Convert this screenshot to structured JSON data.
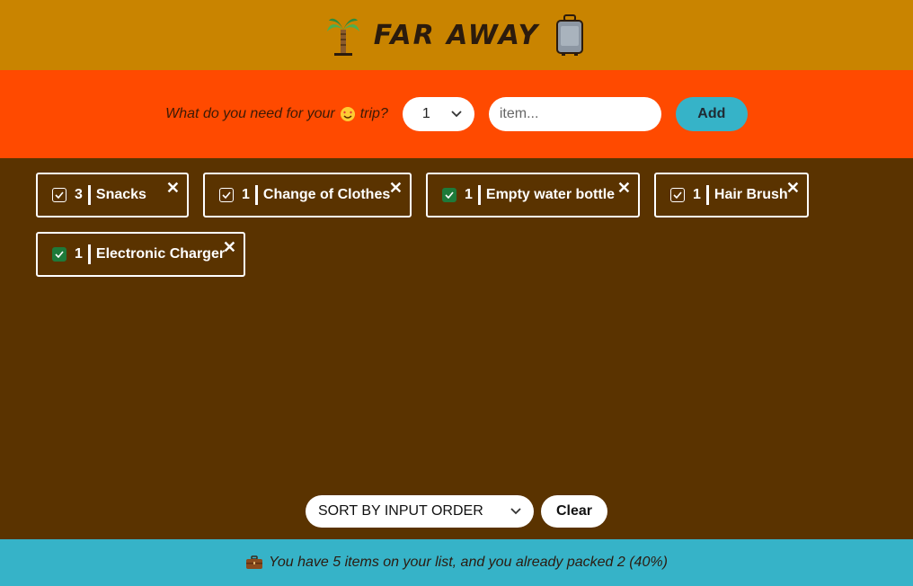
{
  "header": {
    "title": "FAR AWAY",
    "left_icon": "palm-tree-icon",
    "right_icon": "luggage-icon"
  },
  "form": {
    "question": "What do you need for your",
    "question_suffix": "trip?",
    "question_emoji": "heart-eyes-face-icon",
    "qty_value": "1",
    "item_placeholder": "item...",
    "add_label": "Add"
  },
  "items": [
    {
      "qty": "3",
      "name": "Snacks",
      "packed": false
    },
    {
      "qty": "1",
      "name": "Change of Clothes",
      "packed": false
    },
    {
      "qty": "1",
      "name": "Empty water bottle",
      "packed": true
    },
    {
      "qty": "1",
      "name": "Hair Brush",
      "packed": false
    },
    {
      "qty": "1",
      "name": "Electronic Charger",
      "packed": true
    }
  ],
  "controls": {
    "sort_label": "SORT BY INPUT ORDER",
    "clear_label": "Clear"
  },
  "stats": {
    "icon": "briefcase-icon",
    "text": "You have 5 items on your list, and you already packed 2 (40%)"
  },
  "colors": {
    "header_bg": "#c98400",
    "form_bg": "#ff4a00",
    "list_bg": "#5a3300",
    "stats_bg": "#36b3c8",
    "checked": "#1e7a3a"
  }
}
